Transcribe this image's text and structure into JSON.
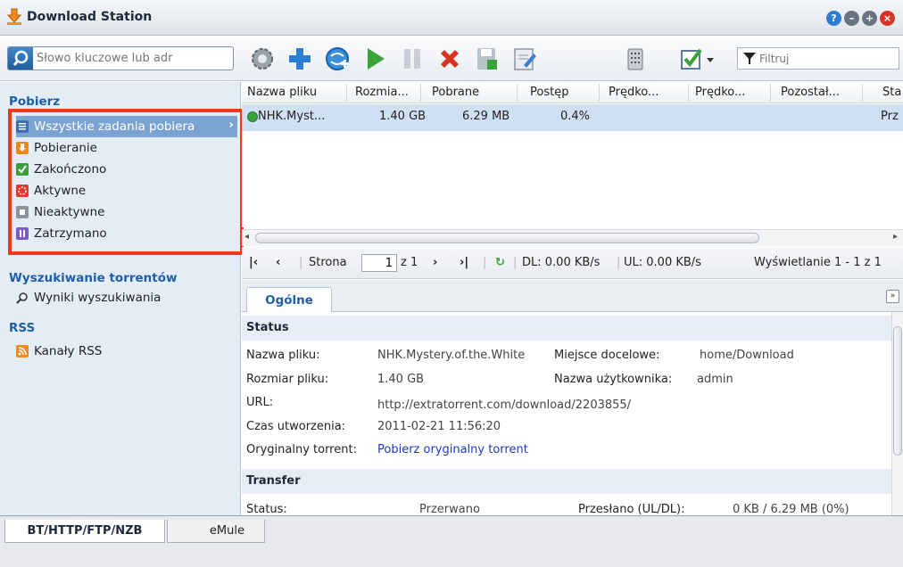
{
  "window": {
    "title": "Download Station",
    "controls": [
      "help",
      "minimize",
      "maximize",
      "close"
    ]
  },
  "toolbar": {
    "search_placeholder": "Słowo kluczowe lub adr",
    "filter_placeholder": "Filtruj",
    "icons": [
      "settings-icon",
      "add-icon",
      "add-url-icon",
      "resume-icon",
      "pause-icon",
      "delete-icon",
      "save-icon",
      "edit-icon",
      "clear-completed-icon",
      "select-all-icon"
    ]
  },
  "sidebar": {
    "section_download": "Pobierz",
    "items": [
      {
        "label": "Wszystkie zadania pobiera",
        "icon": "list-icon"
      },
      {
        "label": "Pobieranie",
        "icon": "download-icon"
      },
      {
        "label": "Zakończono",
        "icon": "check-icon"
      },
      {
        "label": "Aktywne",
        "icon": "active-icon"
      },
      {
        "label": "Nieaktywne",
        "icon": "inactive-icon"
      },
      {
        "label": "Zatrzymano",
        "icon": "paused-icon"
      }
    ],
    "section_torrent": "Wyszukiwanie torrentów",
    "search_results": "Wyniki wyszukiwania",
    "section_rss": "RSS",
    "rss_feeds": "Kanały RSS"
  },
  "grid": {
    "columns": [
      "Nazwa pliku",
      "Rozmia...",
      "Pobrane",
      "Postęp",
      "Prędko...",
      "Prędko...",
      "Pozostał...",
      "Sta"
    ],
    "rows": [
      {
        "name": "NHK.Myst...",
        "size": "1.40 GB",
        "downloaded": "6.29 MB",
        "progress": "0.4%",
        "status": "Prz"
      }
    ]
  },
  "pager": {
    "page_label": "Strona",
    "page_value": "1",
    "of_label": "z 1",
    "dl": "DL: 0.00 KB/s",
    "ul": "UL: 0.00 KB/s",
    "display": "Wyświetlanie 1 - 1 z 1"
  },
  "details": {
    "tab": "Ogólne",
    "status_header": "Status",
    "file_name_label": "Nazwa pliku:",
    "file_name_value": "NHK.Mystery.of.the.White",
    "destination_label": "Miejsce docelowe:",
    "destination_value": "home/Download",
    "file_size_label": "Rozmiar pliku:",
    "file_size_value": "1.40 GB",
    "user_label": "Nazwa użytkownika:",
    "user_value": "admin",
    "url_label": "URL:",
    "url_value": "http://extratorrent.com/download/2203855/",
    "created_label": "Czas utworzenia:",
    "created_value": "2011-02-21 11:56:20",
    "torrent_label": "Oryginalny torrent:",
    "torrent_link": "Pobierz oryginalny torrent",
    "transfer_header": "Transfer",
    "transfer_status_label": "Status:",
    "transfer_status_value": "Przerwano",
    "transferred_label": "Przesłano (UL/DL):",
    "transferred_value": "0 KB / 6.29 MB (0%)"
  },
  "bottom_tabs": [
    "BT/HTTP/FTP/NZB",
    "eMule"
  ],
  "colors": {
    "accent": "#1d5fa8",
    "selected": "#7ba3d2",
    "highlight_box": "#ee3a1b"
  }
}
